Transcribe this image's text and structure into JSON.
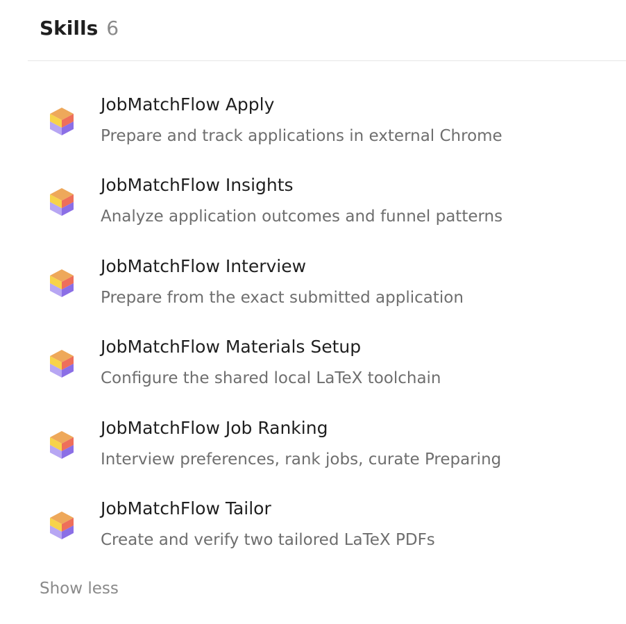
{
  "section": {
    "title": "Skills",
    "count": "6",
    "toggle_label": "Show less"
  },
  "skills": [
    {
      "name": "JobMatchFlow Apply",
      "description": "Prepare and track applications in external Chrome",
      "icon": "cube-icon"
    },
    {
      "name": "JobMatchFlow Insights",
      "description": "Analyze application outcomes and funnel patterns",
      "icon": "cube-icon"
    },
    {
      "name": "JobMatchFlow Interview",
      "description": "Prepare from the exact submitted application",
      "icon": "cube-icon"
    },
    {
      "name": "JobMatchFlow Materials Setup",
      "description": "Configure the shared local LaTeX toolchain",
      "icon": "cube-icon"
    },
    {
      "name": "JobMatchFlow Job Ranking",
      "description": "Interview preferences, rank jobs, curate Preparing",
      "icon": "cube-icon"
    },
    {
      "name": "JobMatchFlow Tailor",
      "description": "Create and verify two tailored LaTeX PDFs",
      "icon": "cube-icon"
    }
  ],
  "colors": {
    "cube_top": "#eea85a",
    "cube_left_top": "#f7d34a",
    "cube_right_top": "#ee6f5a",
    "cube_left_bottom": "#b7a6f3",
    "cube_right_bottom": "#8b6fe6"
  }
}
